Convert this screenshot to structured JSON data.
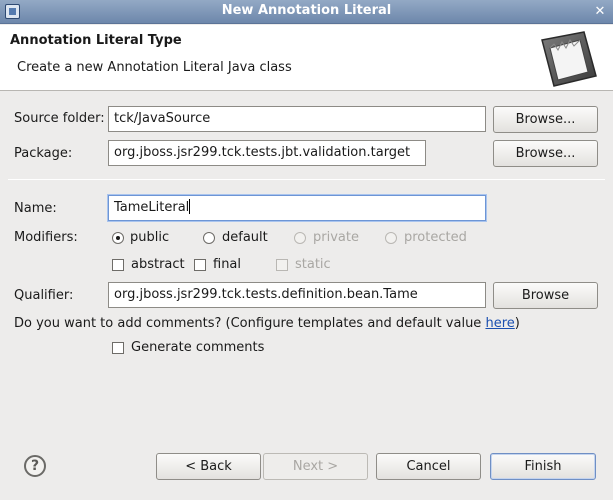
{
  "window": {
    "title": "New Annotation Literal",
    "close_glyph": "✕"
  },
  "banner": {
    "title": "Annotation Literal Type",
    "description": "Create a new Annotation Literal Java class",
    "image_icon": "wizard-banner-icon"
  },
  "form": {
    "source_folder": {
      "label": "Source folder:",
      "value": "tck/JavaSource",
      "browse_label": "Browse..."
    },
    "package": {
      "label": "Package:",
      "value": "org.jboss.jsr299.tck.tests.jbt.validation.target",
      "browse_label": "Browse..."
    },
    "name": {
      "label": "Name:",
      "value": "TameLiteral"
    },
    "modifiers": {
      "label": "Modifiers:",
      "access": [
        {
          "label": "public",
          "checked": true,
          "enabled": true
        },
        {
          "label": "default",
          "checked": false,
          "enabled": true
        },
        {
          "label": "private",
          "checked": false,
          "enabled": false
        },
        {
          "label": "protected",
          "checked": false,
          "enabled": false
        }
      ],
      "flags": [
        {
          "label": "abstract",
          "checked": false,
          "enabled": true
        },
        {
          "label": "final",
          "checked": false,
          "enabled": true
        },
        {
          "label": "static",
          "checked": false,
          "enabled": false
        }
      ]
    },
    "qualifier": {
      "label": "Qualifier:",
      "value": "org.jboss.jsr299.tck.tests.definition.bean.Tame",
      "browse_label": "Browse"
    },
    "comments": {
      "question": "Do you want to add comments? (Configure templates and default value ",
      "link": "here",
      "suffix": ")",
      "generate_label": "Generate comments"
    }
  },
  "footer": {
    "help_glyph": "?",
    "back_label": "< Back",
    "next_label": "Next >",
    "cancel_label": "Cancel",
    "finish_label": "Finish"
  }
}
